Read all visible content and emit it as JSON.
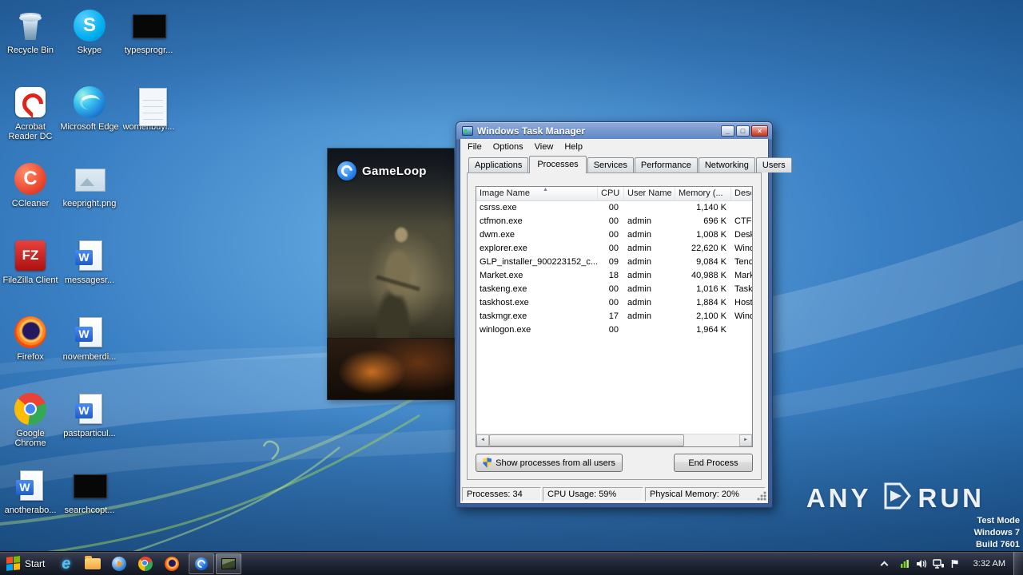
{
  "colors": {
    "desktop_glow": "#6db4e8",
    "desktop_base": "#3a80c4",
    "desktop_deep": "#1d5c99",
    "titlebar_top": "#8fabd9",
    "frame": "#4a6da6",
    "dialog_bg": "#f0f0f0",
    "taskbar_dark": "#121620",
    "streak_green": "#9fd35f",
    "watermark_white": "#ffffff"
  },
  "desktop": {
    "col1": [
      {
        "label": "Recycle Bin",
        "type": "recycle"
      },
      {
        "label": "Acrobat Reader DC",
        "type": "acrobat"
      },
      {
        "label": "CCleaner",
        "type": "ccleaner"
      },
      {
        "label": "FileZilla Client",
        "type": "filezilla"
      },
      {
        "label": "Firefox",
        "type": "firefox"
      },
      {
        "label": "Google Chrome",
        "type": "chrome"
      },
      {
        "label": "anotherabo...",
        "type": "word"
      }
    ],
    "col2": [
      {
        "label": "Skype",
        "type": "skype"
      },
      {
        "label": "Microsoft Edge",
        "type": "edge"
      },
      {
        "label": "keepright.png",
        "type": "image"
      },
      {
        "label": "messagesr...",
        "type": "word"
      },
      {
        "label": "novemberdi...",
        "type": "word"
      },
      {
        "label": "pastparticul...",
        "type": "word"
      },
      {
        "label": "searchcopt...",
        "type": "blackfile"
      }
    ],
    "col3": [
      {
        "label": "typesprogr...",
        "type": "blackfile"
      },
      {
        "label": "womenbuyi...",
        "type": "page"
      }
    ]
  },
  "gameloop": {
    "brand": "GameLoop"
  },
  "task_manager": {
    "title": "Windows Task Manager",
    "window_controls": {
      "minimize": "_",
      "maximize": "□",
      "close": "×"
    },
    "menu": [
      "File",
      "Options",
      "View",
      "Help"
    ],
    "tabs": [
      {
        "label": "Applications"
      },
      {
        "label": "Processes",
        "cls": "active"
      },
      {
        "label": "Services"
      },
      {
        "label": "Performance"
      },
      {
        "label": "Networking"
      },
      {
        "label": "Users"
      }
    ],
    "columns": {
      "name": "Image Name",
      "cpu": "CPU",
      "user": "User Name",
      "memory": "Memory (...",
      "desc": "Desc"
    },
    "sort_indicator": "▲",
    "processes": [
      {
        "name": "csrss.exe",
        "cpu": "00",
        "user": "",
        "memory": "1,140 K",
        "desc": ""
      },
      {
        "name": "ctfmon.exe",
        "cpu": "00",
        "user": "admin",
        "memory": "696 K",
        "desc": "CTF l"
      },
      {
        "name": "dwm.exe",
        "cpu": "00",
        "user": "admin",
        "memory": "1,008 K",
        "desc": "Desk"
      },
      {
        "name": "explorer.exe",
        "cpu": "00",
        "user": "admin",
        "memory": "22,620 K",
        "desc": "Wind"
      },
      {
        "name": "GLP_installer_900223152_c...",
        "cpu": "09",
        "user": "admin",
        "memory": "9,084 K",
        "desc": "Tenc"
      },
      {
        "name": "Market.exe",
        "cpu": "18",
        "user": "admin",
        "memory": "40,988 K",
        "desc": "Mark"
      },
      {
        "name": "taskeng.exe",
        "cpu": "00",
        "user": "admin",
        "memory": "1,016 K",
        "desc": "Task"
      },
      {
        "name": "taskhost.exe",
        "cpu": "00",
        "user": "admin",
        "memory": "1,884 K",
        "desc": "Host"
      },
      {
        "name": "taskmgr.exe",
        "cpu": "17",
        "user": "admin",
        "memory": "2,100 K",
        "desc": "Wind"
      },
      {
        "name": "winlogon.exe",
        "cpu": "00",
        "user": "",
        "memory": "1,964 K",
        "desc": ""
      }
    ],
    "scroll_left": "◄",
    "scroll_right": "►",
    "show_all_button": "Show processes from all users",
    "end_process_button": "End Process",
    "status": {
      "processes": "Processes: 34",
      "cpu": "CPU Usage: 59%",
      "memory": "Physical Memory: 20%"
    }
  },
  "watermark": {
    "left": "ANY",
    "right": "RUN",
    "mode": "Test Mode",
    "os": "Windows 7",
    "build": "Build 7601"
  },
  "taskbar": {
    "start_label": "Start",
    "quick_launch": [
      "internet-explorer",
      "explorer-folder",
      "media-player",
      "chrome",
      "firefox"
    ],
    "running_apps": [
      "gameloop",
      "image-window"
    ],
    "clock": "3:32 AM"
  }
}
